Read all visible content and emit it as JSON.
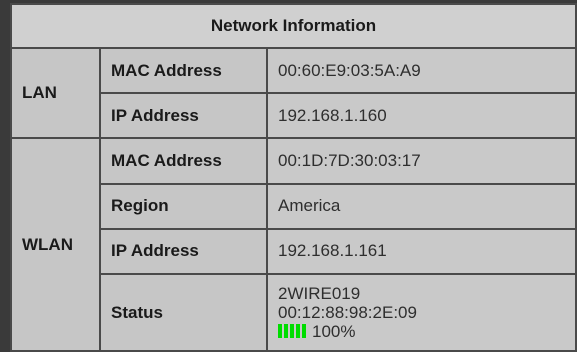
{
  "table": {
    "title": "Network Information",
    "lan": {
      "label": "LAN",
      "rows": [
        {
          "label": "MAC Address",
          "value": "00:60:E9:03:5A:A9"
        },
        {
          "label": "IP Address",
          "value": "192.168.1.160"
        }
      ]
    },
    "wlan": {
      "label": "WLAN",
      "rows": [
        {
          "label": "MAC Address",
          "value": "00:1D:7D:30:03:17"
        },
        {
          "label": "Region",
          "value": "America"
        },
        {
          "label": "IP Address",
          "value": "192.168.1.161"
        }
      ],
      "status": {
        "label": "Status",
        "ssid": "2WIRE019",
        "bssid": "00:12:88:98:2E:09",
        "signal_percent": "100%",
        "signal_bars": 5,
        "signal_color": "#00dd00"
      }
    }
  }
}
